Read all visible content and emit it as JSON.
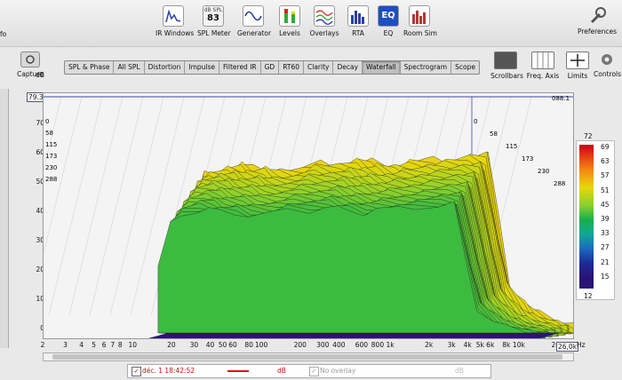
{
  "toolbar": {
    "left_info": "fo",
    "buttons": [
      {
        "id": "ir-windows",
        "label": "IR Windows",
        "icon": "ir-windows-icon"
      },
      {
        "id": "spl-meter",
        "label": "SPL Meter",
        "icon": "spl-meter-icon",
        "display_top": "dB SPL",
        "display_value": "83"
      },
      {
        "id": "generator",
        "label": "Generator",
        "icon": "generator-icon"
      },
      {
        "id": "levels",
        "label": "Levels",
        "icon": "levels-icon"
      },
      {
        "id": "overlays",
        "label": "Overlays",
        "icon": "overlays-icon"
      },
      {
        "id": "rta",
        "label": "RTA",
        "icon": "rta-icon"
      },
      {
        "id": "eq",
        "label": "EQ",
        "icon": "eq-icon"
      },
      {
        "id": "room-sim",
        "label": "Room Sim",
        "icon": "room-sim-icon"
      }
    ],
    "preferences_label": "Preferences"
  },
  "capture_label": "Capture",
  "tabs": [
    "SPL & Phase",
    "All SPL",
    "Distortion",
    "Impulse",
    "Filtered IR",
    "GD",
    "RT60",
    "Clarity",
    "Decay",
    "Waterfall",
    "Spectrogram",
    "Scope"
  ],
  "active_tab": "Waterfall",
  "right_controls": [
    {
      "label": "Scrollbars",
      "icon": "scrollbars-icon"
    },
    {
      "label": "Freq. Axis",
      "icon": "freq-axis-icon"
    },
    {
      "label": "Limits",
      "icon": "limits-icon"
    },
    {
      "label": "Controls",
      "icon": "gear-icon"
    }
  ],
  "axis": {
    "y_unit": "dB",
    "y_ticks": [
      "70",
      "60",
      "50",
      "40",
      "30",
      "20",
      "10",
      "0"
    ],
    "y_top_readout": "79.3",
    "x_ticks": [
      "2",
      "3",
      "4",
      "5",
      "6",
      "7",
      "8",
      "10",
      "20",
      "30",
      "40",
      "50",
      "60",
      "80",
      "100",
      "200",
      "300",
      "400",
      "600",
      "800",
      "1k",
      "2k",
      "3k",
      "4k",
      "5k",
      "6k",
      "8k",
      "10k",
      "20k"
    ],
    "x_right_readout": "26,0k",
    "x_unit": "Hz",
    "corner_readout": "088.1"
  },
  "time_slices_left": [
    "0",
    "58",
    "115",
    "173",
    "230",
    "288"
  ],
  "time_slices_right": [
    "0",
    "58",
    "115",
    "173",
    "230",
    "288"
  ],
  "color_scale": {
    "top": "72",
    "labels": [
      "69",
      "63",
      "57",
      "51",
      "45",
      "39",
      "33",
      "27",
      "21",
      "15"
    ],
    "bottom": "12"
  },
  "legend": {
    "trace_label": "déc. 1 18:42:52",
    "trace_unit": "dB",
    "trace_color": "#e01010",
    "overlay_label": "No overlay",
    "overlay_unit": "dB"
  },
  "chart_data": {
    "type": "area",
    "title": "",
    "xlabel": "Hz",
    "ylabel": "dB",
    "xscale": "log",
    "ylim": [
      0,
      79.3
    ],
    "xlim": [
      2,
      26000
    ],
    "x": [
      20,
      25,
      30,
      40,
      50,
      60,
      80,
      100,
      150,
      200,
      300,
      400,
      500,
      600,
      800,
      1000,
      1500,
      2000,
      3000,
      4000,
      5000,
      6000,
      8000,
      10000,
      15000,
      20000
    ],
    "series": [
      {
        "values": [
          44,
          60,
          62,
          63,
          64,
          63,
          64,
          62,
          62,
          66,
          65,
          66,
          65,
          66,
          64,
          65,
          66,
          67,
          68,
          68,
          40,
          18,
          10,
          6,
          3,
          2
        ]
      },
      {
        "values": [
          36,
          52,
          56,
          58,
          58,
          57,
          57,
          56,
          56,
          58,
          58,
          59,
          58,
          58,
          57,
          58,
          58,
          59,
          60,
          60,
          34,
          14,
          8,
          5,
          2,
          1
        ]
      },
      {
        "values": [
          28,
          44,
          48,
          50,
          50,
          49,
          49,
          48,
          48,
          50,
          50,
          51,
          50,
          50,
          49,
          50,
          50,
          51,
          52,
          52,
          28,
          12,
          7,
          4,
          2,
          1
        ]
      }
    ]
  }
}
